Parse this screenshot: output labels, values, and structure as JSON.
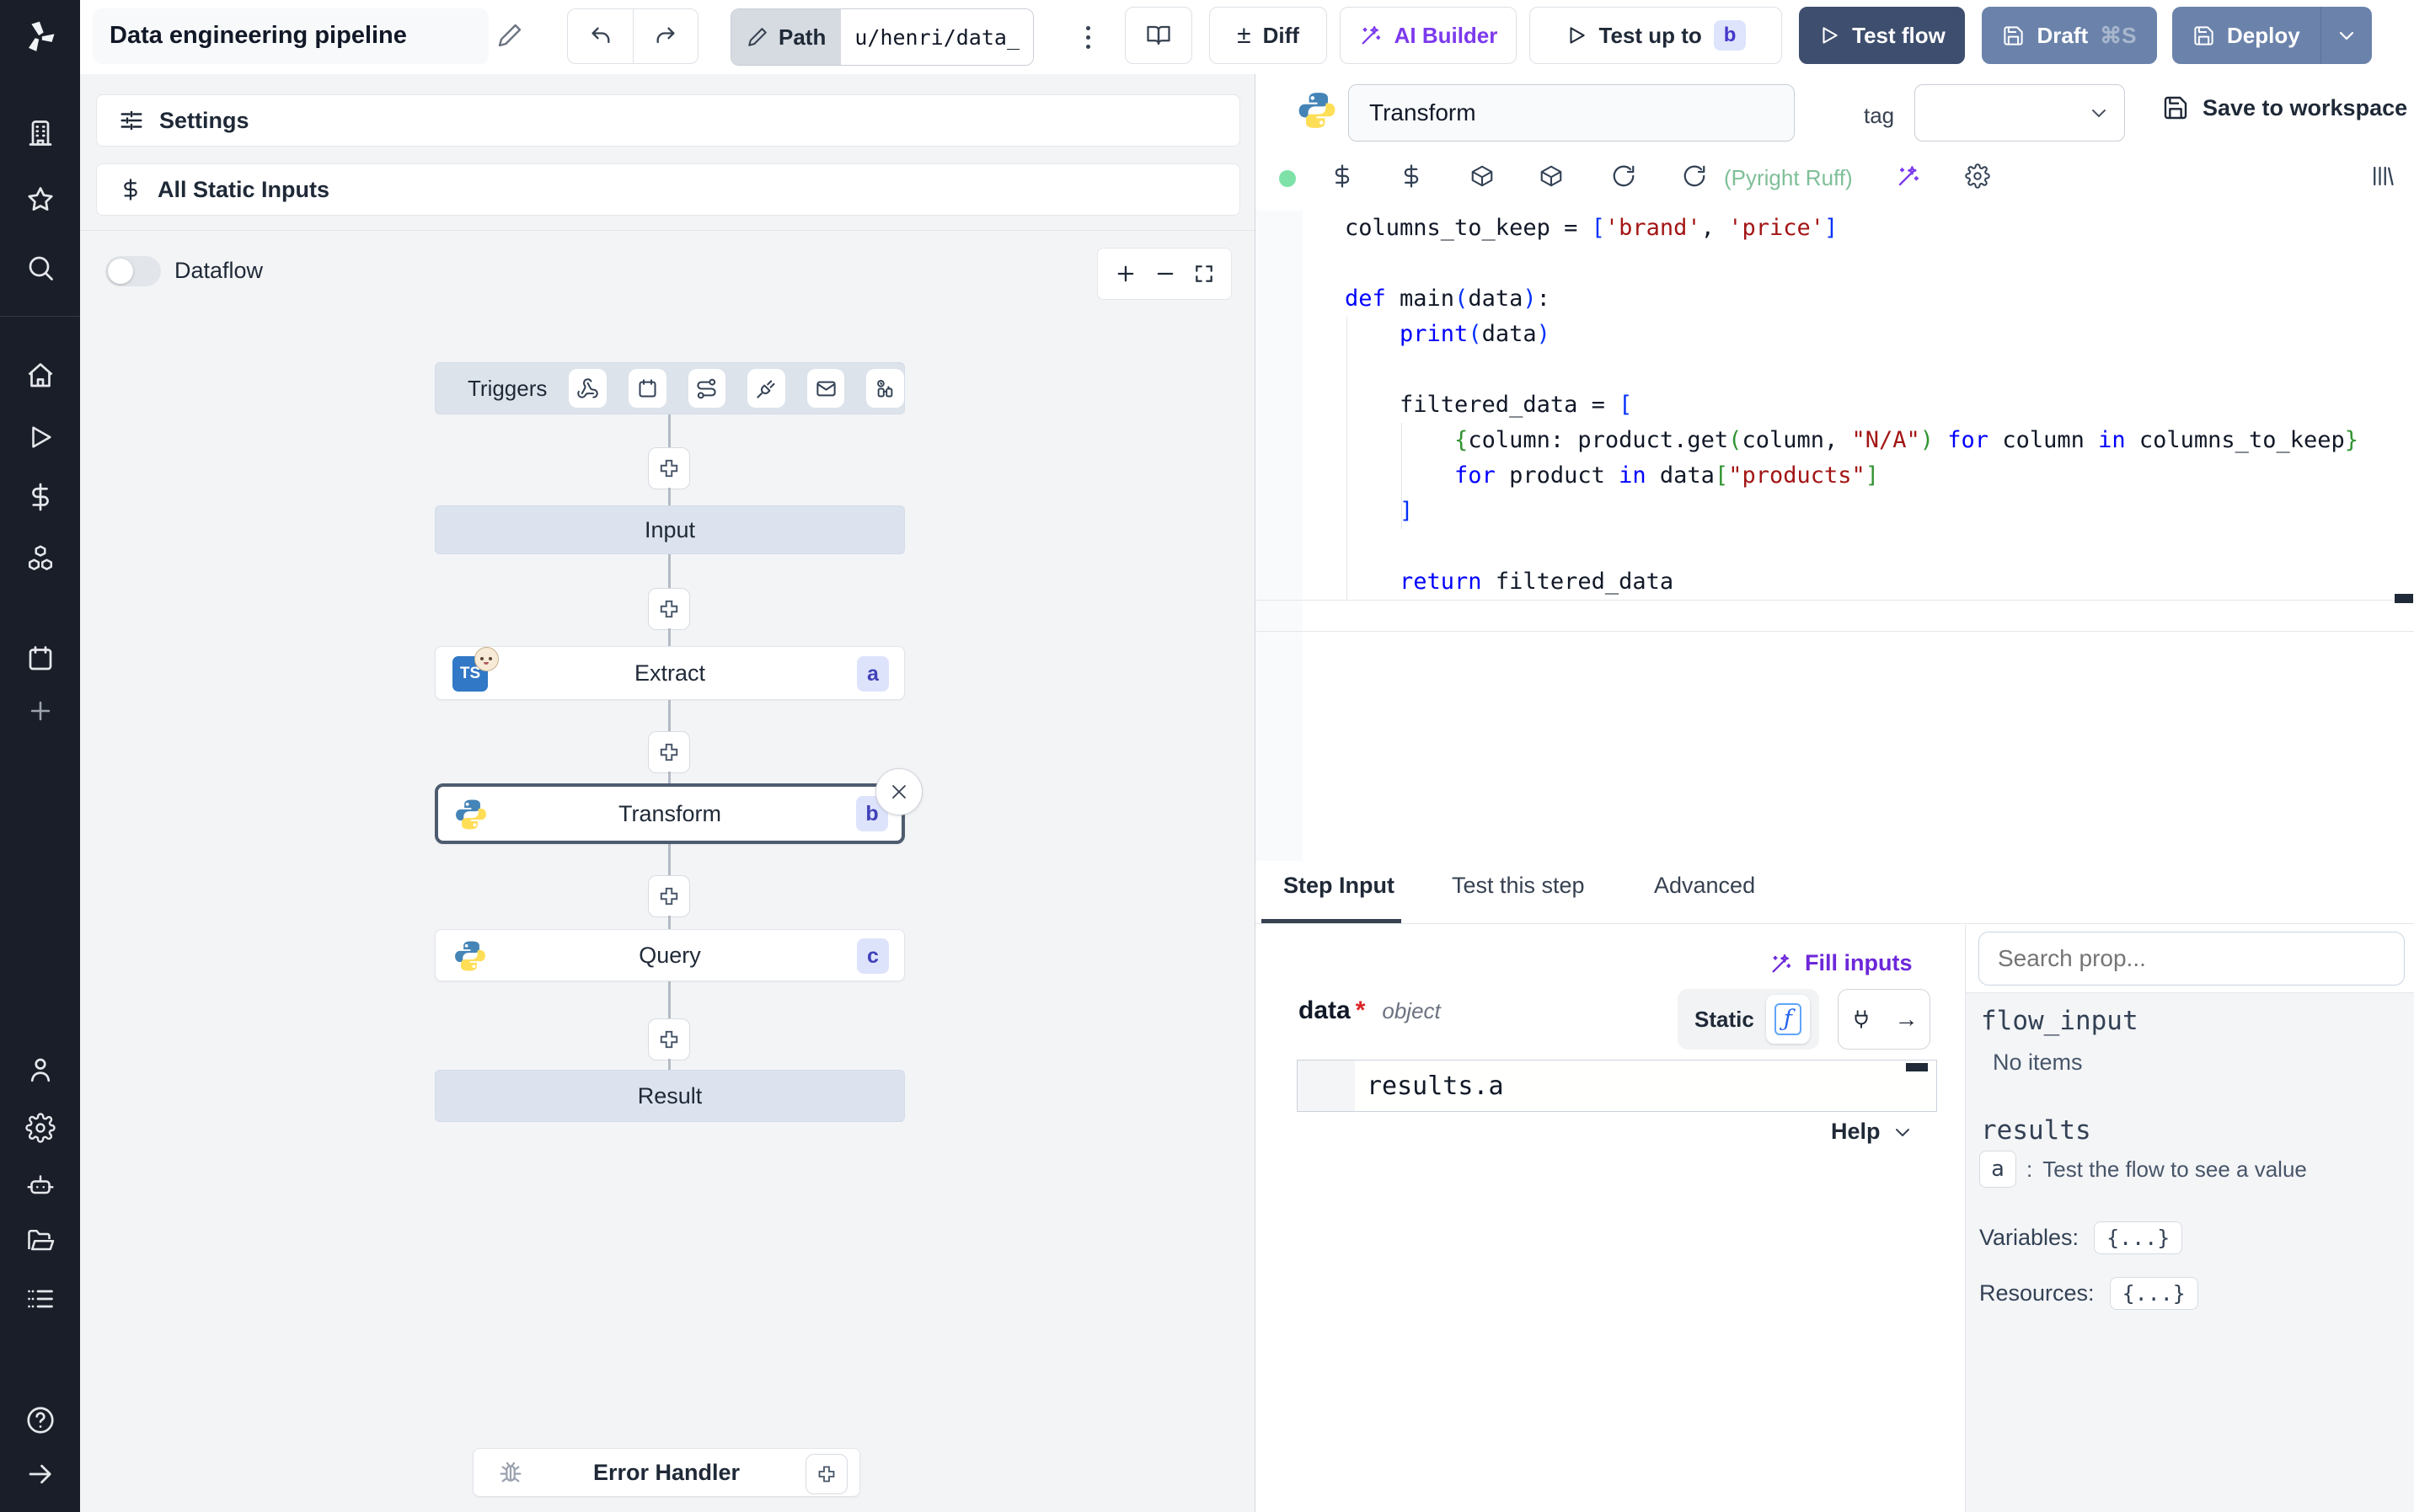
{
  "header": {
    "title": "Data engineering pipeline",
    "path_label": "Path",
    "path_value": "u/henri/data_",
    "diff_sign": "±",
    "diff": "Diff",
    "ai_builder": "AI Builder",
    "test_up_to": "Test up to",
    "test_up_to_badge": "b",
    "test_flow": "Test flow",
    "draft": "Draft",
    "draft_shortcut": "⌘S",
    "deploy": "Deploy"
  },
  "flow": {
    "settings": "Settings",
    "all_static_inputs": "All Static Inputs",
    "dataflow": "Dataflow",
    "triggers": "Triggers",
    "nodes": {
      "input": "Input",
      "extract": {
        "label": "Extract",
        "badge": "a",
        "icon_text": "TS"
      },
      "transform": {
        "label": "Transform",
        "badge": "b"
      },
      "query": {
        "label": "Query",
        "badge": "c"
      },
      "result": "Result",
      "error_handler": "Error Handler"
    }
  },
  "step": {
    "name": "Transform",
    "tag_label": "tag",
    "save": "Save to workspace",
    "lint": "(Pyright Ruff)"
  },
  "editor": {
    "code": [
      [
        [
          "t",
          "columns_to_keep = "
        ],
        [
          "b1",
          "["
        ],
        [
          "s",
          "'brand'"
        ],
        [
          "t",
          ", "
        ],
        [
          "s",
          "'price'"
        ],
        [
          "b1",
          "]"
        ]
      ],
      [],
      [
        [
          "k",
          "def "
        ],
        [
          "t",
          "main"
        ],
        [
          "b1",
          "("
        ],
        [
          "t",
          "data"
        ],
        [
          "b1",
          ")"
        ],
        [
          "t",
          ":"
        ]
      ],
      [
        [
          "t",
          "    "
        ],
        [
          "k",
          "print"
        ],
        [
          "b1",
          "("
        ],
        [
          "t",
          "data"
        ],
        [
          "b1",
          ")"
        ]
      ],
      [],
      [
        [
          "t",
          "    filtered_data = "
        ],
        [
          "b1",
          "["
        ]
      ],
      [
        [
          "t",
          "        "
        ],
        [
          "b2",
          "{"
        ],
        [
          "t",
          "column: product.get"
        ],
        [
          "b2",
          "("
        ],
        [
          "t",
          "column, "
        ],
        [
          "s",
          "\"N/A\""
        ],
        [
          "b2",
          ")"
        ],
        [
          "t",
          " "
        ],
        [
          "k",
          "for"
        ],
        [
          "t",
          " column "
        ],
        [
          "k",
          "in"
        ],
        [
          "t",
          " columns_to_keep"
        ],
        [
          "b2",
          "}"
        ]
      ],
      [
        [
          "t",
          "        "
        ],
        [
          "k",
          "for"
        ],
        [
          "t",
          " product "
        ],
        [
          "k",
          "in"
        ],
        [
          "t",
          " data"
        ],
        [
          "b2",
          "["
        ],
        [
          "s",
          "\"products\""
        ],
        [
          "b2",
          "]"
        ]
      ],
      [
        [
          "t",
          "    "
        ],
        [
          "b1",
          "]"
        ]
      ],
      [],
      [
        [
          "t",
          "    "
        ],
        [
          "k",
          "return"
        ],
        [
          "t",
          " filtered_data"
        ]
      ]
    ]
  },
  "tabs": [
    {
      "label": "Step Input"
    },
    {
      "label": "Test this step"
    },
    {
      "label": "Advanced"
    }
  ],
  "step_input": {
    "fill_inputs": "Fill inputs",
    "field": "data",
    "required_mark": "*",
    "type": "object",
    "static": "Static",
    "fn": "ƒ",
    "arrow": "→",
    "expr": "results.a",
    "help": "Help"
  },
  "props": {
    "search_placeholder": "Search prop...",
    "flow_input": "flow_input",
    "no_items": "No items",
    "results": "results",
    "result_key": "a",
    "colon": ":",
    "result_hint": "Test the flow to see a value",
    "variables": "Variables:",
    "resources": "Resources:",
    "braces": "{...}"
  },
  "colors": {
    "test_flow_bg": "#3e4e6e",
    "deploy_bg": "#6b83ab",
    "purple": "#7c3aed",
    "lint_green": "#7fbf98",
    "badge_bg": "#dee3fc",
    "badge_text": "#4040b8"
  }
}
